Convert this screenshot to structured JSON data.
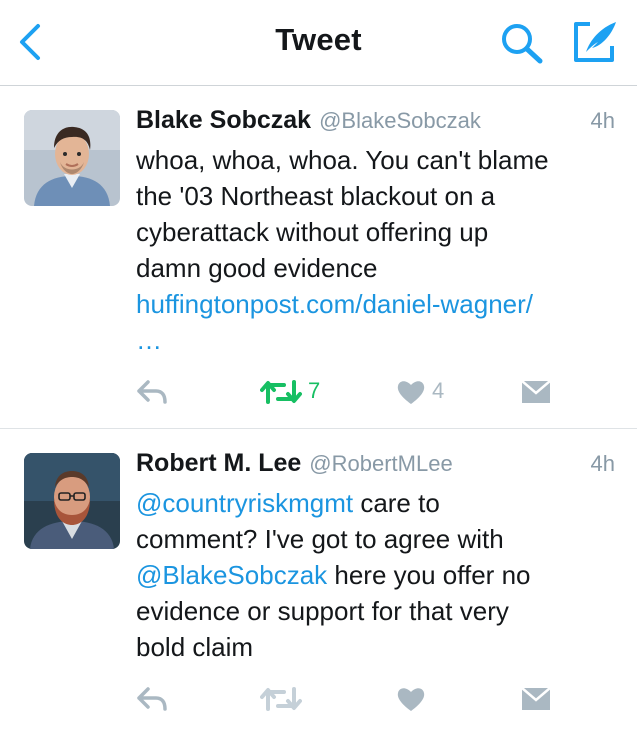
{
  "nav": {
    "title": "Tweet",
    "back_icon": "chevron-left-icon",
    "search_icon": "search-icon",
    "compose_icon": "compose-tweet-icon"
  },
  "colors": {
    "accent": "#1da1f2",
    "link": "#1b95e0",
    "retweet_active": "#17bf63",
    "muted": "#8899a6",
    "action_gray": "#aab8c2"
  },
  "tweets": [
    {
      "name": "Blake Sobczak",
      "handle": "@BlakeSobczak",
      "time": "4h",
      "lines": [
        "whoa, whoa, whoa. You can't blame",
        "the '03 Northeast blackout on a",
        "cyberattack without offering up",
        "damn good evidence"
      ],
      "link": "huffingtonpost.com/daniel-wagner/",
      "ellipsis": "…",
      "retweets": "7",
      "likes": "4",
      "retweeted": true
    },
    {
      "name": "Robert M. Lee",
      "handle": "@RobertMLee",
      "time": "4h",
      "mention1": "@countryriskmgmt",
      "text1": " care to",
      "line2": "comment? I've got to agree with",
      "mention2": "@BlakeSobczak",
      "text3": " here you offer no",
      "line4": "evidence or support for that very",
      "line5": "bold claim"
    }
  ]
}
